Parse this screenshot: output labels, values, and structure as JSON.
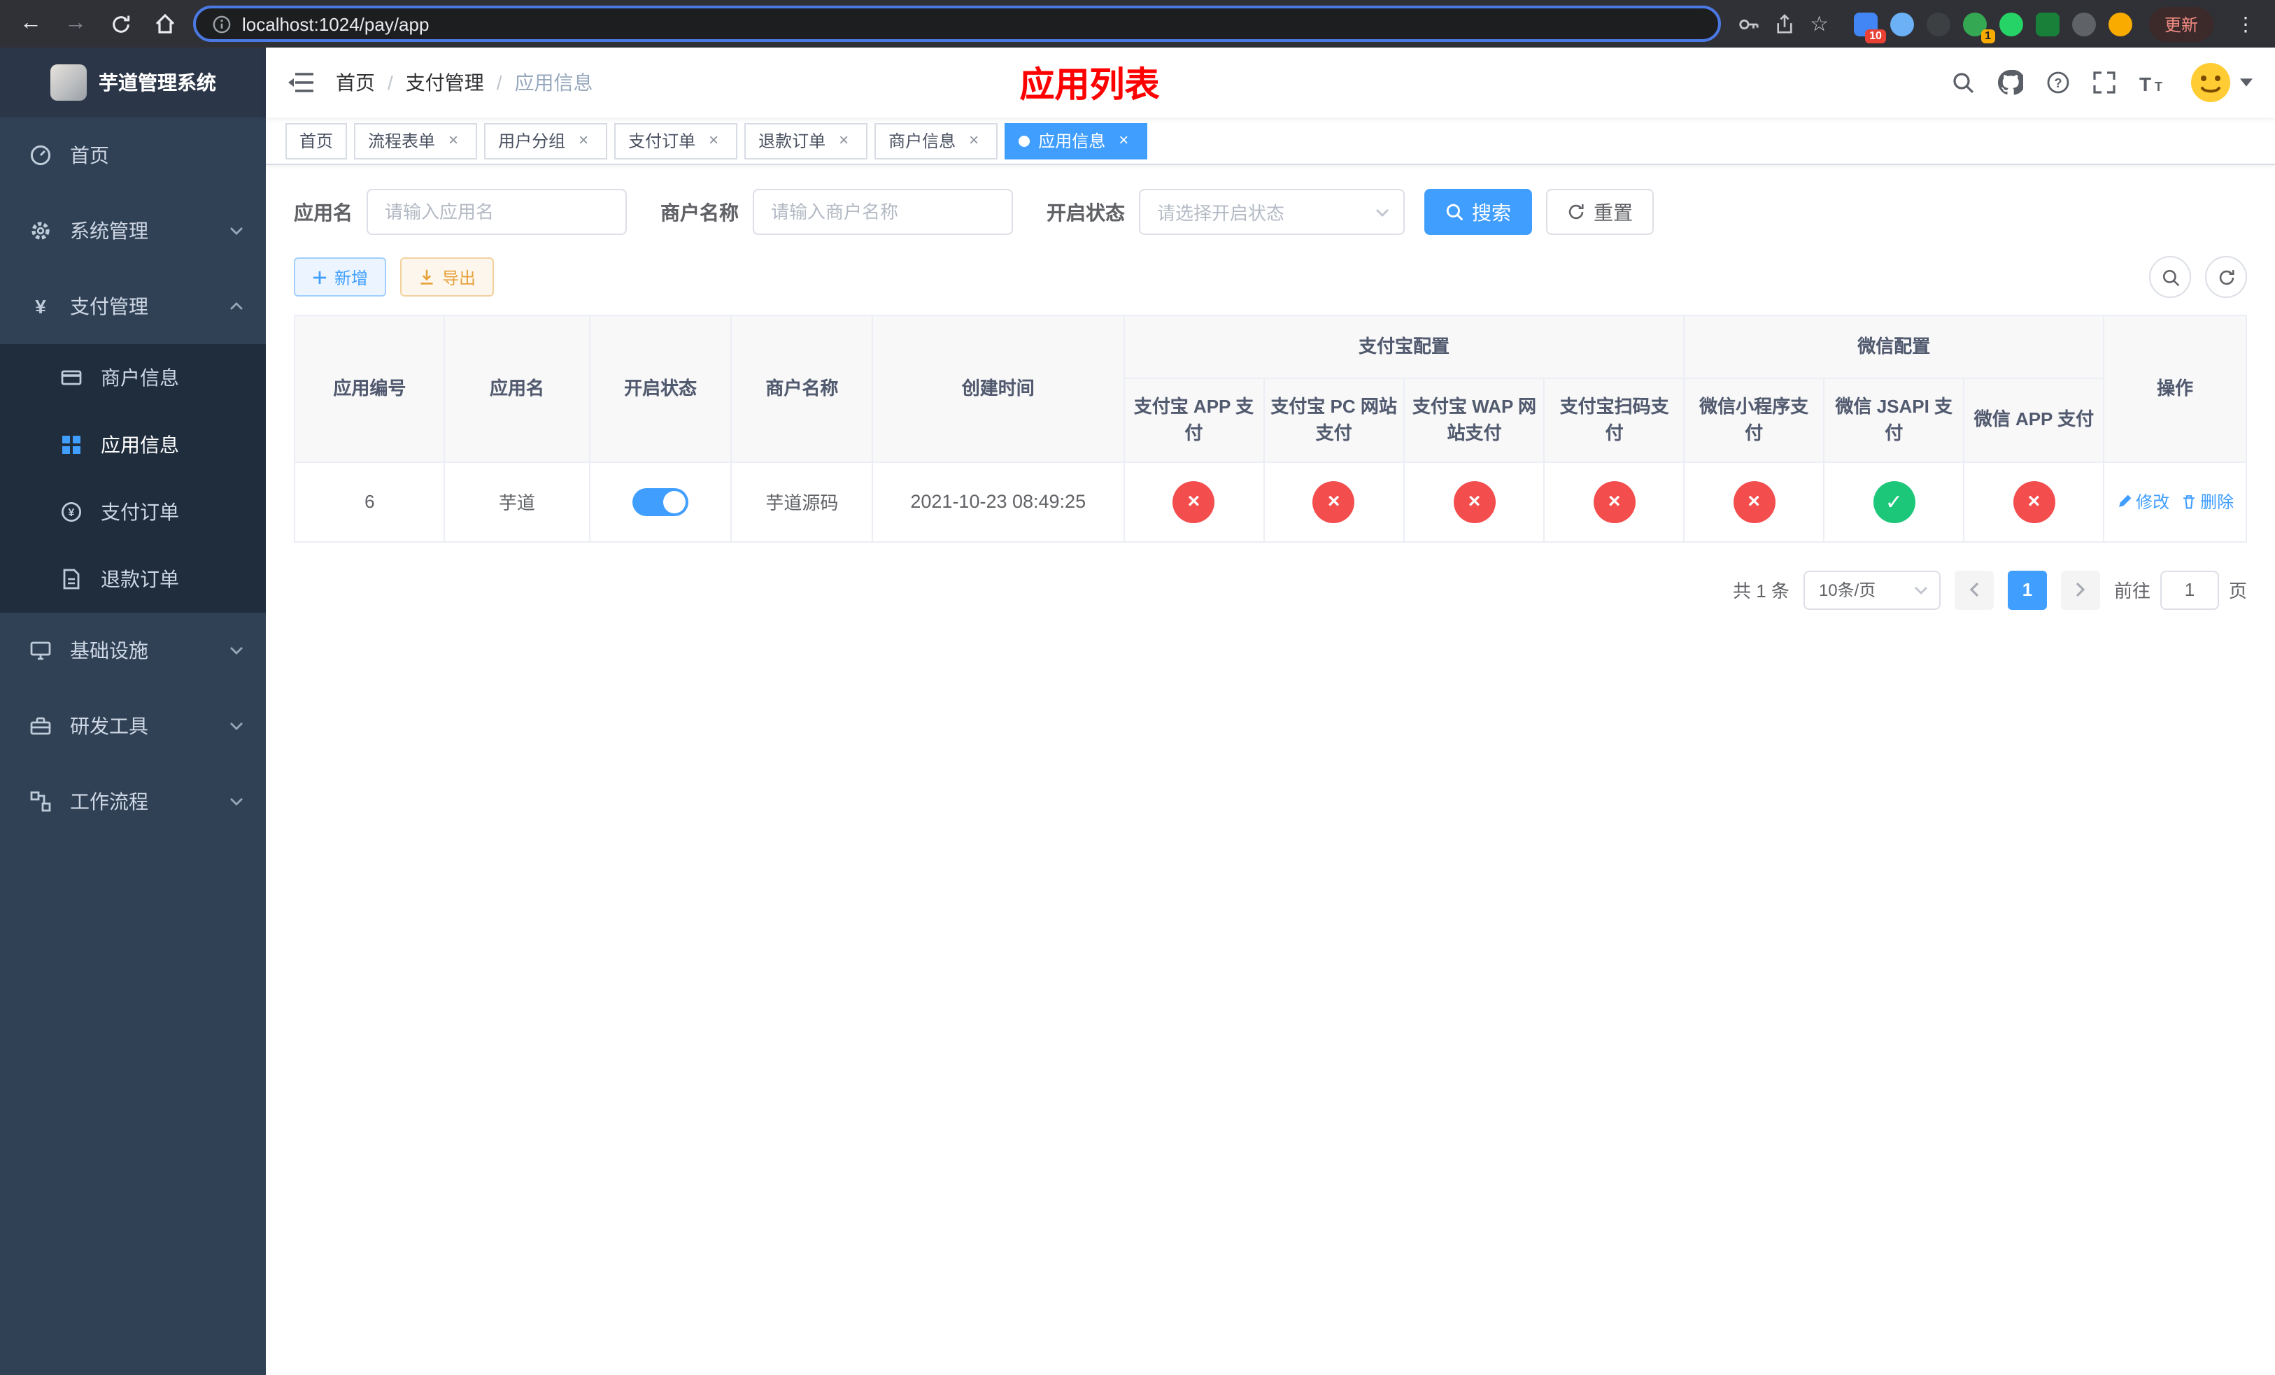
{
  "colors": {
    "accent": "#409eff",
    "status_no": "#f34d4d",
    "status_ok": "#1dc779",
    "sidebar_bg": "#304156",
    "submenu_bg": "#1f2d3d",
    "page_title_red": "#ff0000",
    "export_yellow": "#e6a23c"
  },
  "browser": {
    "url": "localhost:1024/pay/app",
    "update_label": "更新",
    "extension_badges": [
      "10",
      "1"
    ]
  },
  "sidebar": {
    "title": "芋道管理系统",
    "menu": [
      {
        "label": "首页"
      },
      {
        "label": "系统管理"
      },
      {
        "label": "支付管理",
        "children": [
          {
            "label": "商户信息"
          },
          {
            "label": "应用信息"
          },
          {
            "label": "支付订单"
          },
          {
            "label": "退款订单"
          }
        ]
      },
      {
        "label": "基础设施"
      },
      {
        "label": "研发工具"
      },
      {
        "label": "工作流程"
      }
    ]
  },
  "header": {
    "breadcrumb": [
      "首页",
      "支付管理",
      "应用信息"
    ],
    "page_title": "应用列表"
  },
  "tabs": [
    {
      "label": "首页"
    },
    {
      "label": "流程表单"
    },
    {
      "label": "用户分组"
    },
    {
      "label": "支付订单"
    },
    {
      "label": "退款订单"
    },
    {
      "label": "商户信息"
    },
    {
      "label": "应用信息"
    }
  ],
  "filters": {
    "app_name": {
      "label": "应用名",
      "placeholder": "请输入应用名"
    },
    "merchant_name": {
      "label": "商户名称",
      "placeholder": "请输入商户名称"
    },
    "status": {
      "label": "开启状态",
      "placeholder": "请选择开启状态"
    },
    "search_label": "搜索",
    "reset_label": "重置"
  },
  "toolbar": {
    "add_label": "新增",
    "export_label": "导出"
  },
  "table": {
    "headers": {
      "app_id": "应用编号",
      "app_name": "应用名",
      "status": "开启状态",
      "merchant": "商户名称",
      "created": "创建时间",
      "alipay_group": "支付宝配置",
      "wechat_group": "微信配置",
      "actions": "操作",
      "alipay_cols": [
        "支付宝 APP 支付",
        "支付宝 PC 网站支付",
        "支付宝 WAP 网站支付",
        "支付宝扫码支付"
      ],
      "wechat_cols": [
        "微信小程序支付",
        "微信 JSAPI 支付",
        "微信 APP 支付"
      ]
    },
    "rows": [
      {
        "app_id": "6",
        "app_name": "芋道",
        "enabled": true,
        "merchant": "芋道源码",
        "created": "2021-10-23 08:49:25",
        "configs": [
          false,
          false,
          false,
          false,
          false,
          true,
          false
        ],
        "edit_label": "修改",
        "delete_label": "删除"
      }
    ]
  },
  "pagination": {
    "total": "共 1 条",
    "page_size": "10条/页",
    "page": "1",
    "goto_label": "前往",
    "goto_value": "1",
    "unit_label": "页"
  }
}
